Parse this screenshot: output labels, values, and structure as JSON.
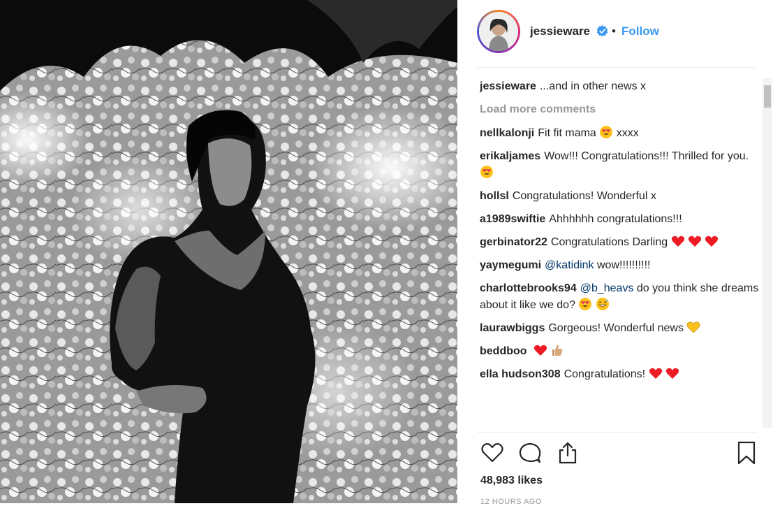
{
  "post": {
    "username": "jessieware",
    "follow_label": "Follow",
    "separator": "•",
    "caption_user": "jessieware",
    "caption_text": "...and in other news x",
    "load_more_label": "Load more comments",
    "likes_text": "48,983 likes",
    "time_text": "12 HOURS AGO"
  },
  "comments": [
    {
      "user": "nellkalonji",
      "text": "Fit fit mama",
      "after": "xxxx"
    },
    {
      "user": "erikaljames",
      "text": "Wow!!! Congratulations!!! Thrilled for you."
    },
    {
      "user": "hollsl",
      "text": "Congratulations! Wonderful x"
    },
    {
      "user": "a1989swiftie",
      "text": "Ahhhhhh congratulations!!!"
    },
    {
      "user": "gerbinator22",
      "text": "Congratulations Darling"
    },
    {
      "user": "yaymegumi",
      "mention": "@katidink",
      "text": "wow!!!!!!!!!!"
    },
    {
      "user": "charlottebrooks94",
      "mention": "@b_heavs",
      "text": "do you think she dreams about it like we do?"
    },
    {
      "user": "laurawbiggs",
      "text": "Gorgeous! Wonderful news"
    },
    {
      "user": "beddboo",
      "text": ""
    },
    {
      "user": "ella hudson308",
      "text": "Congratulations!"
    }
  ],
  "icons": {
    "like": "heart-outline-icon",
    "comment": "comment-bubble-icon",
    "share": "share-icon",
    "save": "bookmark-icon",
    "verified": "verified-badge-icon"
  },
  "colors": {
    "link": "#3897f0",
    "muted": "#999999",
    "heart": "#ed1c24"
  }
}
